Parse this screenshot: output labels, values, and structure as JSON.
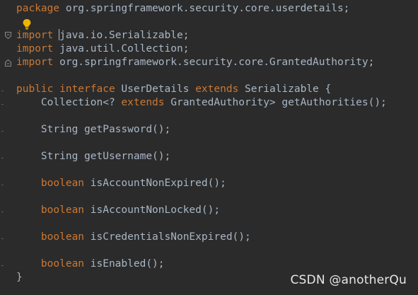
{
  "colors": {
    "background": "#2b2b2b",
    "keyword": "#cc7832",
    "text": "#a9b7c6",
    "intention_bulb": "#f0b400"
  },
  "editor": {
    "intention_icon": "lightbulb-icon",
    "lines": [
      [
        {
          "t": "package",
          "k": "kw"
        },
        {
          "t": " org.springframework.security.core.userdetails;",
          "k": "text"
        }
      ],
      [],
      [
        {
          "t": "import",
          "k": "kw"
        },
        {
          "t": " java.io.Serializable;",
          "k": "text"
        }
      ],
      [
        {
          "t": "import",
          "k": "kw"
        },
        {
          "t": " java.util.Collection;",
          "k": "text"
        }
      ],
      [
        {
          "t": "import",
          "k": "kw"
        },
        {
          "t": " org.springframework.security.core.GrantedAuthority;",
          "k": "text"
        }
      ],
      [],
      [
        {
          "t": "public interface",
          "k": "kw"
        },
        {
          "t": " UserDetails ",
          "k": "text"
        },
        {
          "t": "extends",
          "k": "kw"
        },
        {
          "t": " Serializable {",
          "k": "text"
        }
      ],
      [
        {
          "t": "    Collection<? ",
          "k": "text"
        },
        {
          "t": "extends",
          "k": "kw"
        },
        {
          "t": " GrantedAuthority> getAuthorities();",
          "k": "text"
        }
      ],
      [],
      [
        {
          "t": "    String getPassword();",
          "k": "text"
        }
      ],
      [],
      [
        {
          "t": "    String getUsername();",
          "k": "text"
        }
      ],
      [],
      [
        {
          "t": "    ",
          "k": "text"
        },
        {
          "t": "boolean",
          "k": "kw"
        },
        {
          "t": " isAccountNonExpired();",
          "k": "text"
        }
      ],
      [],
      [
        {
          "t": "    ",
          "k": "text"
        },
        {
          "t": "boolean",
          "k": "kw"
        },
        {
          "t": " isAccountNonLocked();",
          "k": "text"
        }
      ],
      [],
      [
        {
          "t": "    ",
          "k": "text"
        },
        {
          "t": "boolean",
          "k": "kw"
        },
        {
          "t": " isCredentialsNonExpired();",
          "k": "text"
        }
      ],
      [],
      [
        {
          "t": "    ",
          "k": "text"
        },
        {
          "t": "boolean",
          "k": "kw"
        },
        {
          "t": " isEnabled();",
          "k": "text"
        }
      ],
      [
        {
          "t": "}",
          "k": "text"
        }
      ]
    ]
  },
  "watermark": "CSDN @anotherQu"
}
